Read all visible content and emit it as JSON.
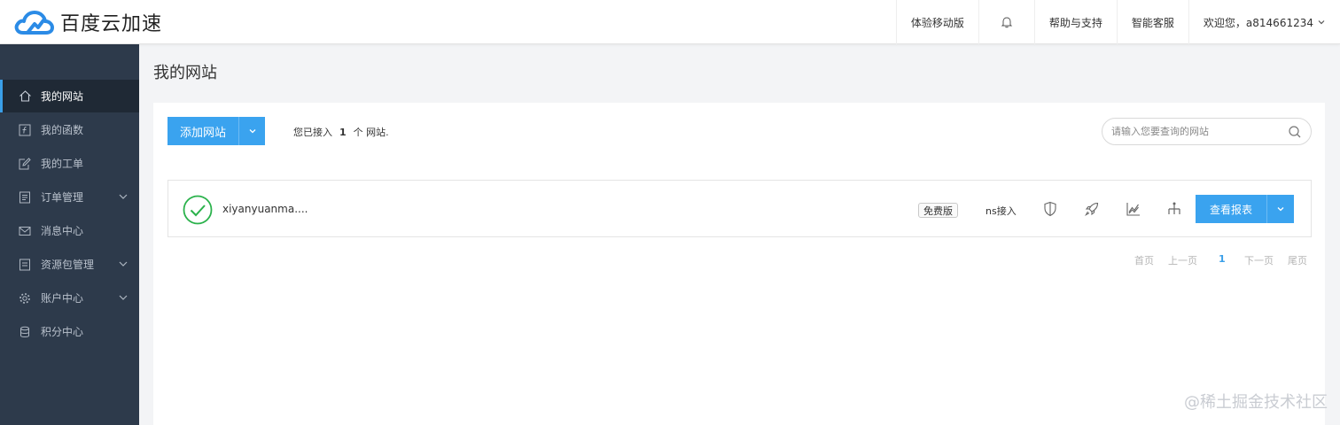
{
  "header": {
    "logo_text": "百度云加速",
    "nav": {
      "mobile": "体验移动版",
      "help": "帮助与支持",
      "service": "智能客服",
      "user": "欢迎您，a814661234"
    },
    "icons": {
      "logo": "cloud-logo-icon",
      "bell": "bell-icon",
      "user_caret": "chevron-down-icon"
    }
  },
  "sidebar": {
    "items": [
      {
        "label": "我的网站",
        "icon": "home-icon",
        "active": true,
        "expandable": false
      },
      {
        "label": "我的函数",
        "icon": "function-icon",
        "active": false,
        "expandable": false
      },
      {
        "label": "我的工单",
        "icon": "edit-icon",
        "active": false,
        "expandable": false
      },
      {
        "label": "订单管理",
        "icon": "document-icon",
        "active": false,
        "expandable": true
      },
      {
        "label": "消息中心",
        "icon": "mail-icon",
        "active": false,
        "expandable": false
      },
      {
        "label": "资源包管理",
        "icon": "package-icon",
        "active": false,
        "expandable": true
      },
      {
        "label": "账户中心",
        "icon": "gear-icon",
        "active": false,
        "expandable": true
      },
      {
        "label": "积分中心",
        "icon": "database-icon",
        "active": false,
        "expandable": false
      }
    ]
  },
  "main": {
    "title": "我的网站",
    "add_button": "添加网站",
    "count_prefix": "您已接入",
    "count_value": "1",
    "count_suffix": "个 网站.",
    "search_placeholder": "请输入您要查询的网站",
    "sites": [
      {
        "domain": "xiyanyuanma....",
        "status": "active",
        "plan": "免费版",
        "access": "ns接入",
        "report_button": "查看报表",
        "actions": [
          "shield-icon",
          "rocket-icon",
          "chart-icon",
          "sitemap-icon"
        ]
      }
    ],
    "pagination": {
      "first": "首页",
      "prev": "上一页",
      "current": "1",
      "next": "下一页",
      "last": "尾页"
    }
  },
  "watermark": "@稀土掘金技术社区",
  "colors": {
    "primary": "#3aa3ef",
    "sidebar_bg": "#2d3a4b",
    "sidebar_active": "#1f2935",
    "success": "#2bb24c"
  }
}
